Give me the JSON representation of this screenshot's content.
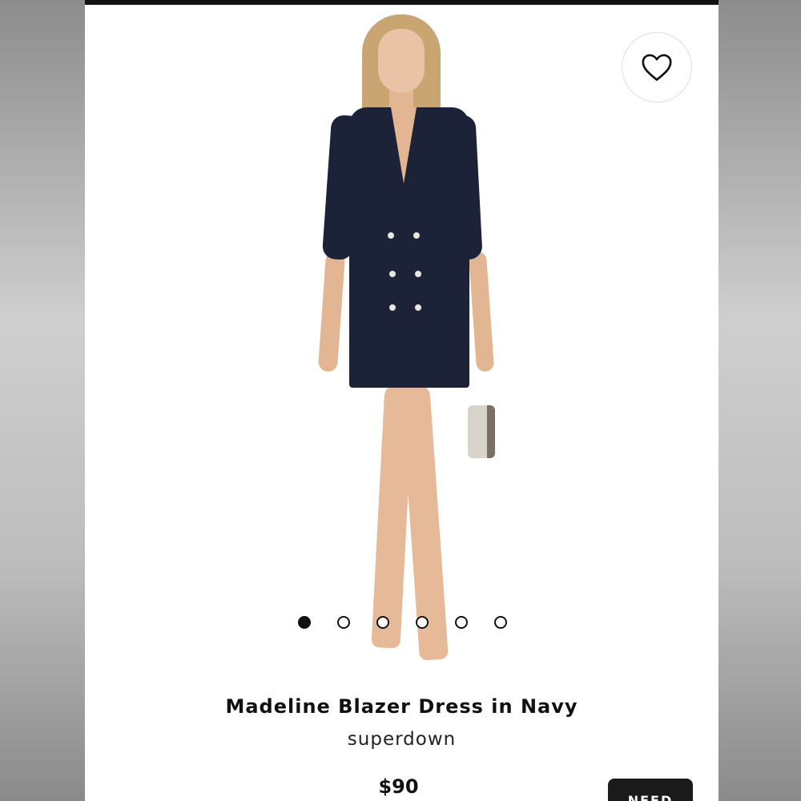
{
  "product": {
    "title": "Madeline Blazer Dress in Navy",
    "brand": "superdown",
    "price": "$90",
    "image_subject": "model wearing navy double-breasted blazer dress",
    "cta_label": "NEED"
  },
  "carousel": {
    "total": 6,
    "active_index": 0
  },
  "favorite": {
    "icon": "heart-outline-icon",
    "active": false
  },
  "colors": {
    "top_bar": "#111111",
    "dress": "#1c2238",
    "accent": "#111111",
    "cta_bg": "#1a1a1a"
  }
}
